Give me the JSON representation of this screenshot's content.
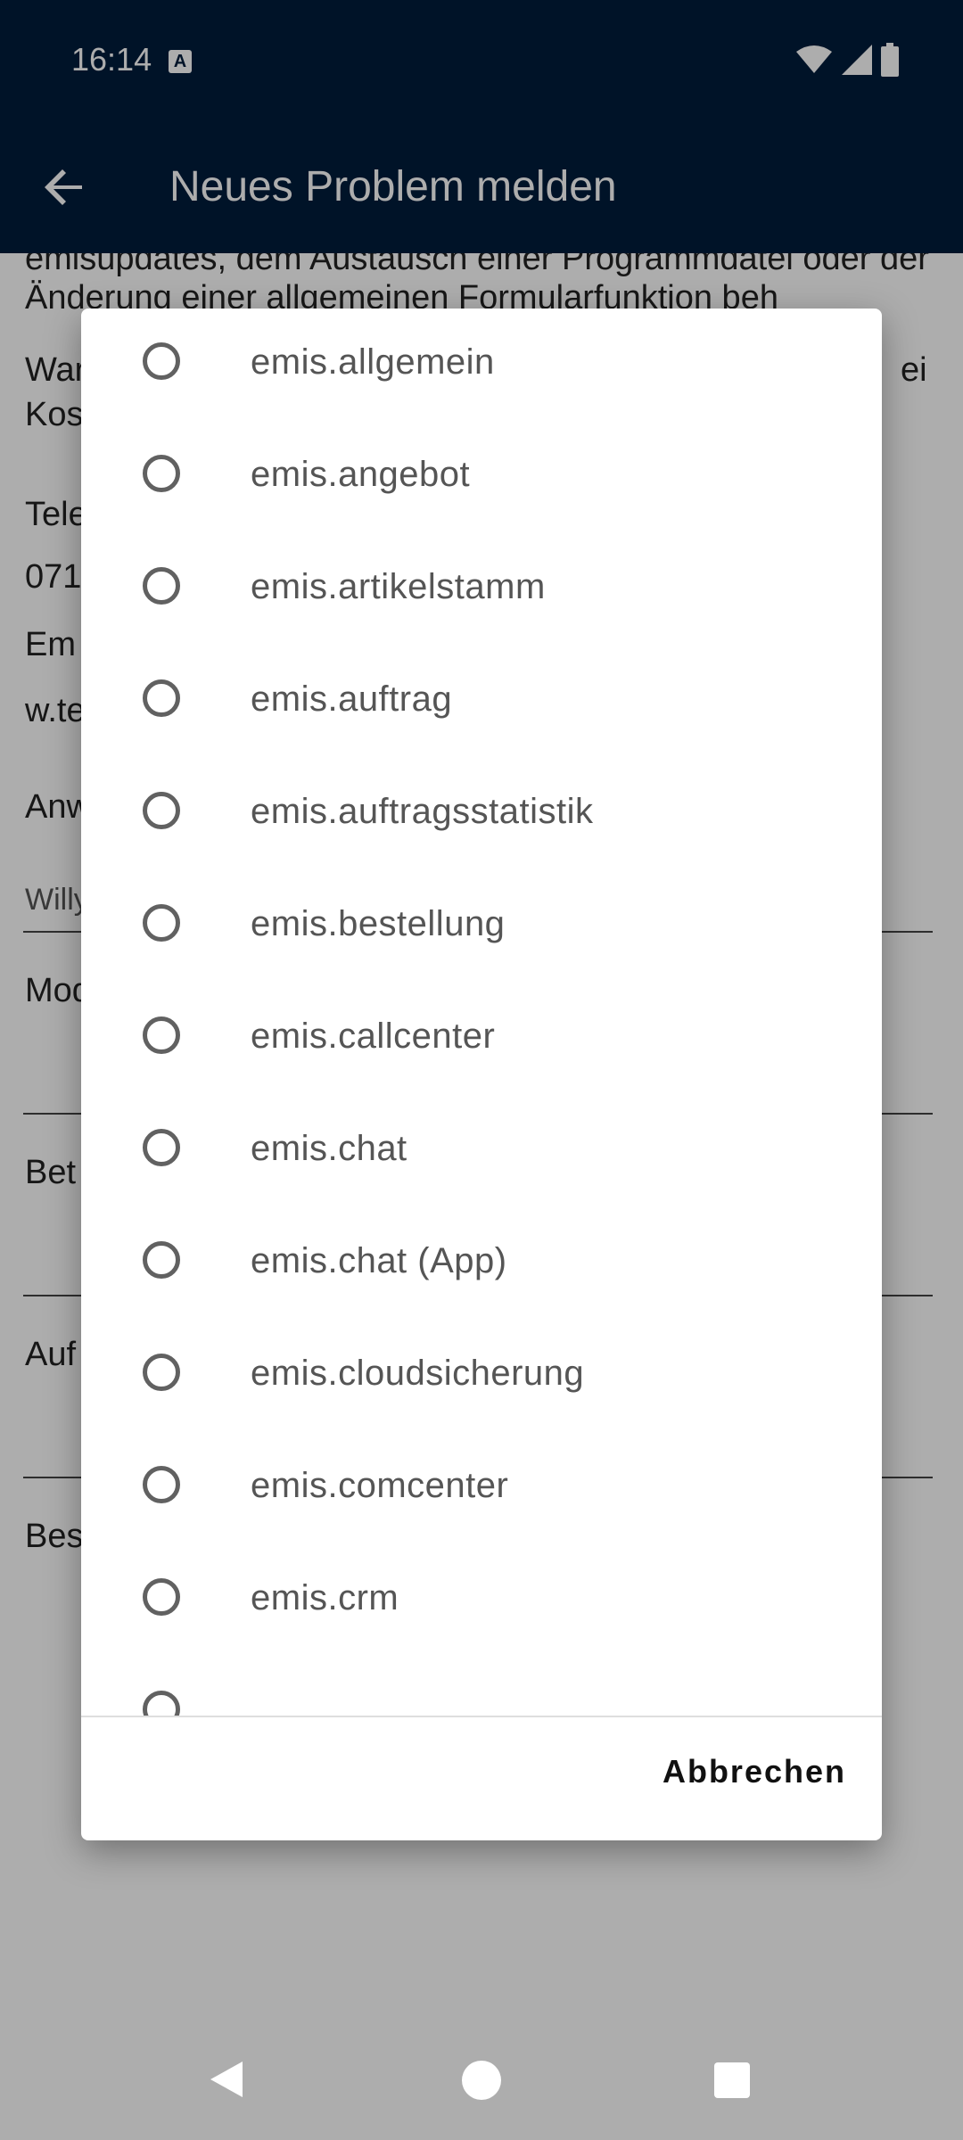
{
  "status_bar": {
    "time": "16:14",
    "notification_icon": "a-icon",
    "icons": [
      "wifi-icon",
      "signal-icon",
      "battery-icon"
    ]
  },
  "app_bar": {
    "title": "Neues Problem melden",
    "back_icon": "arrow-back-icon",
    "color": "#001c3b"
  },
  "background": {
    "paragraph": "emisupdates, dem Austausch einer Programmdatei oder der Änderung einer allgemeinen Formularfunktion beh",
    "line_war": "War",
    "line_war_suffix": "ei",
    "line_kos": "Kos",
    "line_tele": "Tele",
    "line_071": "071",
    "line_em": "Em",
    "line_wte": "w.te",
    "line_anw": "Anw",
    "line_willy": "Willy",
    "line_mod": "Mod",
    "line_bet": "Bet",
    "line_auf": "Auf",
    "line_bes": "Bes"
  },
  "dialog": {
    "options": [
      "emis.allgemein",
      "emis.angebot",
      "emis.artikelstamm",
      "emis.auftrag",
      "emis.auftragsstatistik",
      "emis.bestellung",
      "emis.callcenter",
      "emis.chat",
      "emis.chat (App)",
      "emis.cloudsicherung",
      "emis.comcenter",
      "emis.crm"
    ],
    "cancel_label": "Abbrechen"
  },
  "nav_bar": {
    "icons": [
      "nav-back-icon",
      "nav-home-icon",
      "nav-recents-icon"
    ]
  }
}
